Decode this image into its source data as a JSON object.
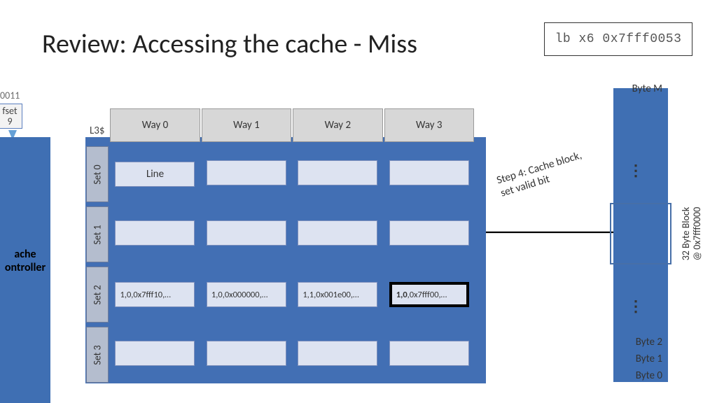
{
  "title": "Review: Accessing the cache - Miss",
  "instruction": "lb x6 0x7fff0053",
  "left": {
    "binary_suffix": "0011",
    "offset_label_a": "fset",
    "offset_label_b": "9",
    "controller_a": "ache",
    "controller_b": "ontroller"
  },
  "cache": {
    "name": "L3$",
    "ways": [
      "Way 0",
      "Way 1",
      "Way 2",
      "Way 3"
    ],
    "sets": [
      "Set 0",
      "Set 1",
      "Set 2",
      "Set 3"
    ],
    "line_label": "Line",
    "set2": {
      "way0": "1,0,0x7fff10,…",
      "way1": "1,0,0x000000,…",
      "way2": "1,1,0x001e00,…",
      "way3_prefix": "1,0",
      "way3_rest": ",0x7fff00,…"
    }
  },
  "memory": {
    "top": "Byte M",
    "b2": "Byte 2",
    "b1": "Byte 1",
    "b0": "Byte 0",
    "block_line1": "32 Byte Block",
    "block_line2": "@ 0x7fff0000"
  },
  "step4": {
    "line1": "Step 4: Cache block,",
    "line2": "set valid bit"
  },
  "chart_data": {
    "type": "table",
    "description": "4-way set-associative L3 cache, 4 sets, on a miss loading address 0x7fff0053",
    "ways": 4,
    "sets": 4,
    "accessed_address": "0x7fff0053",
    "target_set": 2,
    "fill_way": 3,
    "set2_entries": [
      {
        "way": 0,
        "valid": 1,
        "dirty": 0,
        "tag": "0x7fff10"
      },
      {
        "way": 1,
        "valid": 1,
        "dirty": 0,
        "tag": "0x000000"
      },
      {
        "way": 2,
        "valid": 1,
        "dirty": 1,
        "tag": "0x001e00"
      },
      {
        "way": 3,
        "valid": 1,
        "dirty": 0,
        "tag": "0x7fff00"
      }
    ],
    "memory_block": {
      "size_bytes": 32,
      "base_address": "0x7fff0000"
    }
  }
}
